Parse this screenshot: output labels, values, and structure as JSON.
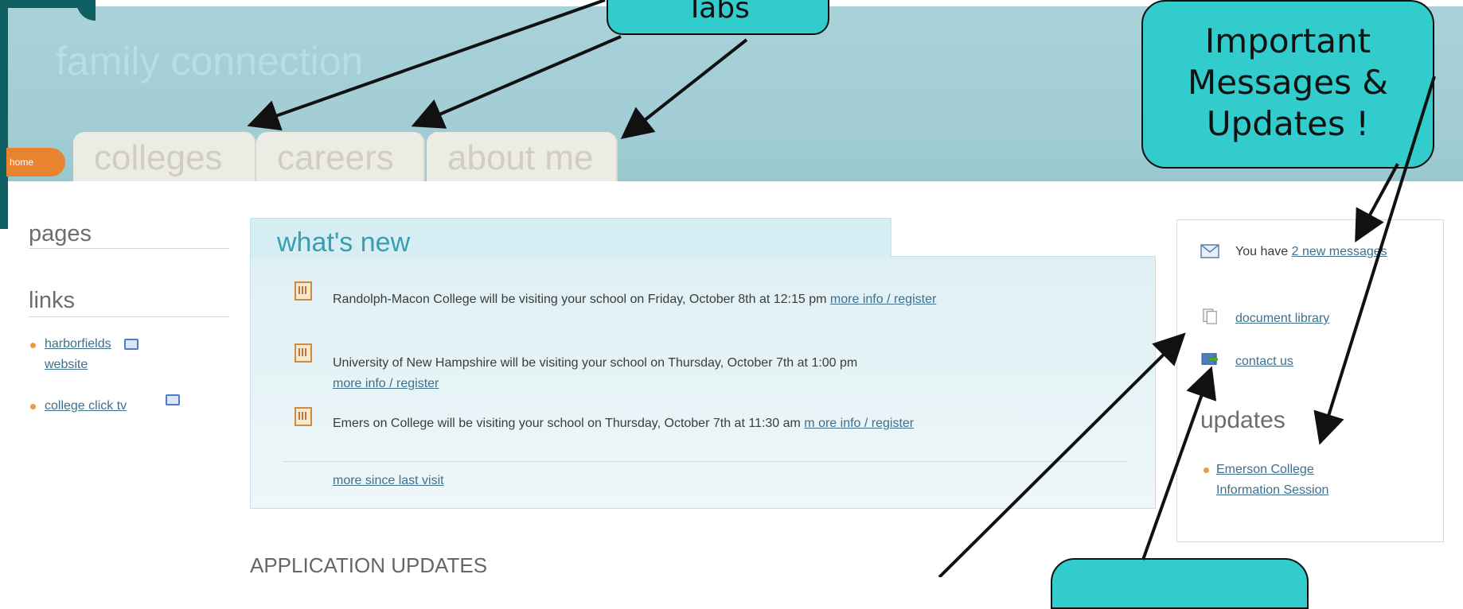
{
  "header": {
    "brand": "family connection",
    "home_label": "home",
    "tabs": [
      {
        "label": "colleges"
      },
      {
        "label": "careers"
      },
      {
        "label": "about me"
      }
    ]
  },
  "callouts": {
    "tabs": "Tabs",
    "messages": [
      "Important",
      "Messages &",
      "Updates !"
    ]
  },
  "sidebar": {
    "pages_heading": "pages",
    "links_heading": "links",
    "links": [
      {
        "label_line1": "harborfields",
        "label_line2": "website"
      },
      {
        "label": "college click tv"
      }
    ]
  },
  "whats_new": {
    "title": "what's new",
    "events": [
      {
        "text": "Randolph-Macon College will be visiting your school on Friday, October 8th at 12:15 pm ",
        "link": "more info / register"
      },
      {
        "text": "University of New Hampshire will be visiting your school on Thursday, October 7th at 1:00 pm ",
        "link": "more info / register"
      },
      {
        "text": "Emers on College will be visiting your school on Thursday, October 7th at 11:30 am ",
        "link": "m ore info / register"
      }
    ],
    "more_since": "more since last visit"
  },
  "application_updates": "APPLICATION UPDATES",
  "right_panel": {
    "messages_prefix": "You have ",
    "messages_link": "2 new messages",
    "document_library": "document library",
    "contact_us": "contact us",
    "updates_heading": "updates",
    "update_item": "Emerson College Information Session"
  },
  "colors": {
    "header_bg": "#a5cfd6",
    "accent_orange": "#e8842e",
    "callout_bg": "#33cccc",
    "link": "#3f6f8a"
  }
}
